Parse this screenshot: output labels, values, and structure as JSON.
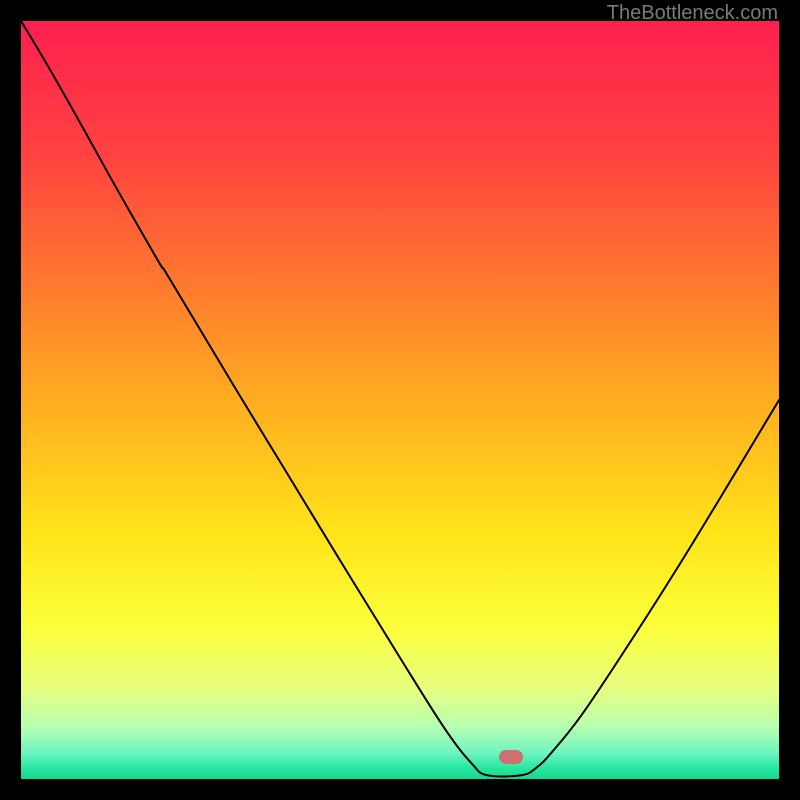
{
  "watermark": "TheBottleneck.com",
  "marker": {
    "x_pct": 64.7,
    "y_pct": 97.1
  },
  "chart_data": {
    "type": "line",
    "title": "",
    "xlabel": "",
    "ylabel": "",
    "xlim": [
      0,
      100
    ],
    "ylim": [
      0,
      100
    ],
    "grid": false,
    "background": {
      "type": "vertical-gradient",
      "stops": [
        {
          "offset": 0.0,
          "color": "#ff1f4f"
        },
        {
          "offset": 0.18,
          "color": "#ff4340"
        },
        {
          "offset": 0.35,
          "color": "#ff7a2e"
        },
        {
          "offset": 0.52,
          "color": "#ffb31f"
        },
        {
          "offset": 0.68,
          "color": "#ffe51a"
        },
        {
          "offset": 0.8,
          "color": "#fbff3a"
        },
        {
          "offset": 0.88,
          "color": "#e8ff80"
        },
        {
          "offset": 0.93,
          "color": "#b8ffb0"
        },
        {
          "offset": 0.965,
          "color": "#70f5c0"
        },
        {
          "offset": 0.985,
          "color": "#28e8a0"
        },
        {
          "offset": 1.0,
          "color": "#18d890"
        }
      ]
    },
    "series": [
      {
        "name": "bottleneck-curve",
        "color": "#000000",
        "stroke_width": 2,
        "x": [
          0.0,
          3.0,
          7.0,
          12.0,
          18.0,
          19.0,
          22.0,
          28.0,
          35.0,
          42.0,
          50.0,
          56.0,
          59.5,
          61.5,
          66.0,
          68.0,
          70.0,
          74.0,
          80.0,
          87.0,
          94.0,
          100.0
        ],
        "y": [
          100.0,
          95.0,
          88.0,
          79.0,
          68.5,
          67.0,
          62.0,
          52.0,
          40.5,
          29.0,
          16.0,
          6.5,
          2.0,
          0.5,
          0.5,
          1.5,
          3.5,
          8.5,
          17.5,
          28.5,
          40.0,
          50.0
        ]
      }
    ],
    "annotations": [
      {
        "type": "marker",
        "shape": "rounded-rect",
        "color": "#cf7070",
        "x": 64.7,
        "y": 0.6
      }
    ]
  }
}
